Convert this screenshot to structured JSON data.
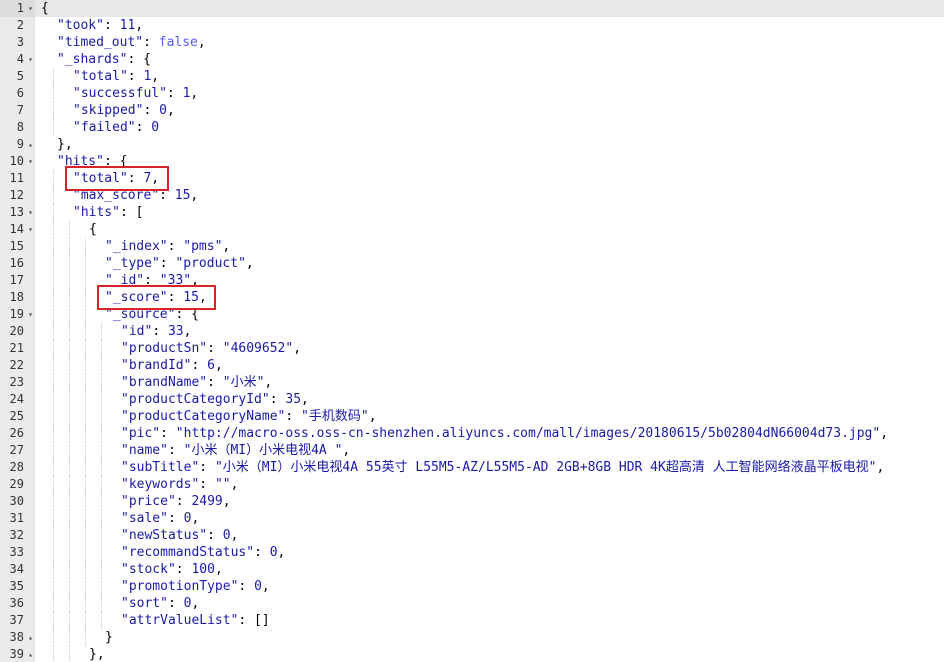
{
  "editor": {
    "active_line": 1,
    "highlight_color": "#d8232a",
    "lines": [
      {
        "n": 1,
        "indent": 0,
        "fold": "▾",
        "tokens": [
          {
            "t": "p",
            "v": "{"
          }
        ]
      },
      {
        "n": 2,
        "indent": 1,
        "tokens": [
          {
            "t": "k",
            "v": "\"took\""
          },
          {
            "t": "p",
            "v": ": "
          },
          {
            "t": "n",
            "v": "11"
          },
          {
            "t": "p",
            "v": ","
          }
        ]
      },
      {
        "n": 3,
        "indent": 1,
        "tokens": [
          {
            "t": "k",
            "v": "\"timed_out\""
          },
          {
            "t": "p",
            "v": ": "
          },
          {
            "t": "b",
            "v": "false"
          },
          {
            "t": "p",
            "v": ","
          }
        ]
      },
      {
        "n": 4,
        "indent": 1,
        "fold": "▾",
        "tokens": [
          {
            "t": "k",
            "v": "\"_shards\""
          },
          {
            "t": "p",
            "v": ": {"
          }
        ]
      },
      {
        "n": 5,
        "indent": 2,
        "tokens": [
          {
            "t": "k",
            "v": "\"total\""
          },
          {
            "t": "p",
            "v": ": "
          },
          {
            "t": "n",
            "v": "1"
          },
          {
            "t": "p",
            "v": ","
          }
        ]
      },
      {
        "n": 6,
        "indent": 2,
        "tokens": [
          {
            "t": "k",
            "v": "\"successful\""
          },
          {
            "t": "p",
            "v": ": "
          },
          {
            "t": "n",
            "v": "1"
          },
          {
            "t": "p",
            "v": ","
          }
        ]
      },
      {
        "n": 7,
        "indent": 2,
        "tokens": [
          {
            "t": "k",
            "v": "\"skipped\""
          },
          {
            "t": "p",
            "v": ": "
          },
          {
            "t": "n",
            "v": "0"
          },
          {
            "t": "p",
            "v": ","
          }
        ]
      },
      {
        "n": 8,
        "indent": 2,
        "tokens": [
          {
            "t": "k",
            "v": "\"failed\""
          },
          {
            "t": "p",
            "v": ": "
          },
          {
            "t": "n",
            "v": "0"
          }
        ]
      },
      {
        "n": 9,
        "indent": 1,
        "fold": "▴",
        "tokens": [
          {
            "t": "p",
            "v": "},"
          }
        ]
      },
      {
        "n": 10,
        "indent": 1,
        "fold": "▾",
        "tokens": [
          {
            "t": "k",
            "v": "\"hits\""
          },
          {
            "t": "p",
            "v": ": {"
          }
        ]
      },
      {
        "n": 11,
        "indent": 2,
        "tokens": [
          {
            "t": "k",
            "v": "\"total\""
          },
          {
            "t": "p",
            "v": ": "
          },
          {
            "t": "n",
            "v": "7"
          },
          {
            "t": "p",
            "v": ","
          }
        ]
      },
      {
        "n": 12,
        "indent": 2,
        "tokens": [
          {
            "t": "k",
            "v": "\"max_score\""
          },
          {
            "t": "p",
            "v": ": "
          },
          {
            "t": "n",
            "v": "15"
          },
          {
            "t": "p",
            "v": ","
          }
        ]
      },
      {
        "n": 13,
        "indent": 2,
        "fold": "▾",
        "tokens": [
          {
            "t": "k",
            "v": "\"hits\""
          },
          {
            "t": "p",
            "v": ": ["
          }
        ]
      },
      {
        "n": 14,
        "indent": 3,
        "fold": "▾",
        "tokens": [
          {
            "t": "p",
            "v": "{"
          }
        ]
      },
      {
        "n": 15,
        "indent": 4,
        "tokens": [
          {
            "t": "k",
            "v": "\"_index\""
          },
          {
            "t": "p",
            "v": ": "
          },
          {
            "t": "s",
            "v": "\"pms\""
          },
          {
            "t": "p",
            "v": ","
          }
        ]
      },
      {
        "n": 16,
        "indent": 4,
        "tokens": [
          {
            "t": "k",
            "v": "\"_type\""
          },
          {
            "t": "p",
            "v": ": "
          },
          {
            "t": "s",
            "v": "\"product\""
          },
          {
            "t": "p",
            "v": ","
          }
        ]
      },
      {
        "n": 17,
        "indent": 4,
        "tokens": [
          {
            "t": "k",
            "v": "\"_id\""
          },
          {
            "t": "p",
            "v": ": "
          },
          {
            "t": "s",
            "v": "\"33\""
          },
          {
            "t": "p",
            "v": ","
          }
        ]
      },
      {
        "n": 18,
        "indent": 4,
        "tokens": [
          {
            "t": "k",
            "v": "\"_score\""
          },
          {
            "t": "p",
            "v": ": "
          },
          {
            "t": "n",
            "v": "15"
          },
          {
            "t": "p",
            "v": ","
          }
        ]
      },
      {
        "n": 19,
        "indent": 4,
        "fold": "▾",
        "tokens": [
          {
            "t": "k",
            "v": "\"_source\""
          },
          {
            "t": "p",
            "v": ": {"
          }
        ]
      },
      {
        "n": 20,
        "indent": 5,
        "tokens": [
          {
            "t": "k",
            "v": "\"id\""
          },
          {
            "t": "p",
            "v": ": "
          },
          {
            "t": "n",
            "v": "33"
          },
          {
            "t": "p",
            "v": ","
          }
        ]
      },
      {
        "n": 21,
        "indent": 5,
        "tokens": [
          {
            "t": "k",
            "v": "\"productSn\""
          },
          {
            "t": "p",
            "v": ": "
          },
          {
            "t": "s",
            "v": "\"4609652\""
          },
          {
            "t": "p",
            "v": ","
          }
        ]
      },
      {
        "n": 22,
        "indent": 5,
        "tokens": [
          {
            "t": "k",
            "v": "\"brandId\""
          },
          {
            "t": "p",
            "v": ": "
          },
          {
            "t": "n",
            "v": "6"
          },
          {
            "t": "p",
            "v": ","
          }
        ]
      },
      {
        "n": 23,
        "indent": 5,
        "tokens": [
          {
            "t": "k",
            "v": "\"brandName\""
          },
          {
            "t": "p",
            "v": ": "
          },
          {
            "t": "s",
            "v": "\"小米\""
          },
          {
            "t": "p",
            "v": ","
          }
        ]
      },
      {
        "n": 24,
        "indent": 5,
        "tokens": [
          {
            "t": "k",
            "v": "\"productCategoryId\""
          },
          {
            "t": "p",
            "v": ": "
          },
          {
            "t": "n",
            "v": "35"
          },
          {
            "t": "p",
            "v": ","
          }
        ]
      },
      {
        "n": 25,
        "indent": 5,
        "tokens": [
          {
            "t": "k",
            "v": "\"productCategoryName\""
          },
          {
            "t": "p",
            "v": ": "
          },
          {
            "t": "s",
            "v": "\"手机数码\""
          },
          {
            "t": "p",
            "v": ","
          }
        ]
      },
      {
        "n": 26,
        "indent": 5,
        "tokens": [
          {
            "t": "k",
            "v": "\"pic\""
          },
          {
            "t": "p",
            "v": ": "
          },
          {
            "t": "s",
            "v": "\"http://macro-oss.oss-cn-shenzhen.aliyuncs.com/mall/images/20180615/5b02804dN66004d73.jpg\""
          },
          {
            "t": "p",
            "v": ","
          }
        ]
      },
      {
        "n": 27,
        "indent": 5,
        "tokens": [
          {
            "t": "k",
            "v": "\"name\""
          },
          {
            "t": "p",
            "v": ": "
          },
          {
            "t": "s",
            "v": "\"小米（MI）小米电视4A \""
          },
          {
            "t": "p",
            "v": ","
          }
        ]
      },
      {
        "n": 28,
        "indent": 5,
        "tokens": [
          {
            "t": "k",
            "v": "\"subTitle\""
          },
          {
            "t": "p",
            "v": ": "
          },
          {
            "t": "s",
            "v": "\"小米（MI）小米电视4A 55英寸 L55M5-AZ/L55M5-AD 2GB+8GB HDR 4K超高清 人工智能网络液晶平板电视\""
          },
          {
            "t": "p",
            "v": ","
          }
        ]
      },
      {
        "n": 29,
        "indent": 5,
        "tokens": [
          {
            "t": "k",
            "v": "\"keywords\""
          },
          {
            "t": "p",
            "v": ": "
          },
          {
            "t": "s",
            "v": "\"\""
          },
          {
            "t": "p",
            "v": ","
          }
        ]
      },
      {
        "n": 30,
        "indent": 5,
        "tokens": [
          {
            "t": "k",
            "v": "\"price\""
          },
          {
            "t": "p",
            "v": ": "
          },
          {
            "t": "n",
            "v": "2499"
          },
          {
            "t": "p",
            "v": ","
          }
        ]
      },
      {
        "n": 31,
        "indent": 5,
        "tokens": [
          {
            "t": "k",
            "v": "\"sale\""
          },
          {
            "t": "p",
            "v": ": "
          },
          {
            "t": "n",
            "v": "0"
          },
          {
            "t": "p",
            "v": ","
          }
        ]
      },
      {
        "n": 32,
        "indent": 5,
        "tokens": [
          {
            "t": "k",
            "v": "\"newStatus\""
          },
          {
            "t": "p",
            "v": ": "
          },
          {
            "t": "n",
            "v": "0"
          },
          {
            "t": "p",
            "v": ","
          }
        ]
      },
      {
        "n": 33,
        "indent": 5,
        "tokens": [
          {
            "t": "k",
            "v": "\"recommandStatus\""
          },
          {
            "t": "p",
            "v": ": "
          },
          {
            "t": "n",
            "v": "0"
          },
          {
            "t": "p",
            "v": ","
          }
        ]
      },
      {
        "n": 34,
        "indent": 5,
        "tokens": [
          {
            "t": "k",
            "v": "\"stock\""
          },
          {
            "t": "p",
            "v": ": "
          },
          {
            "t": "n",
            "v": "100"
          },
          {
            "t": "p",
            "v": ","
          }
        ]
      },
      {
        "n": 35,
        "indent": 5,
        "tokens": [
          {
            "t": "k",
            "v": "\"promotionType\""
          },
          {
            "t": "p",
            "v": ": "
          },
          {
            "t": "n",
            "v": "0"
          },
          {
            "t": "p",
            "v": ","
          }
        ]
      },
      {
        "n": 36,
        "indent": 5,
        "tokens": [
          {
            "t": "k",
            "v": "\"sort\""
          },
          {
            "t": "p",
            "v": ": "
          },
          {
            "t": "n",
            "v": "0"
          },
          {
            "t": "p",
            "v": ","
          }
        ]
      },
      {
        "n": 37,
        "indent": 5,
        "tokens": [
          {
            "t": "k",
            "v": "\"attrValueList\""
          },
          {
            "t": "p",
            "v": ": []"
          }
        ]
      },
      {
        "n": 38,
        "indent": 4,
        "fold": "▴",
        "tokens": [
          {
            "t": "p",
            "v": "}"
          }
        ]
      },
      {
        "n": 39,
        "indent": 3,
        "fold": "▴",
        "tokens": [
          {
            "t": "p",
            "v": "},"
          }
        ]
      }
    ],
    "highlights": [
      {
        "line": 11,
        "label": "hits-total-highlight"
      },
      {
        "line": 18,
        "label": "score-highlight"
      }
    ]
  }
}
